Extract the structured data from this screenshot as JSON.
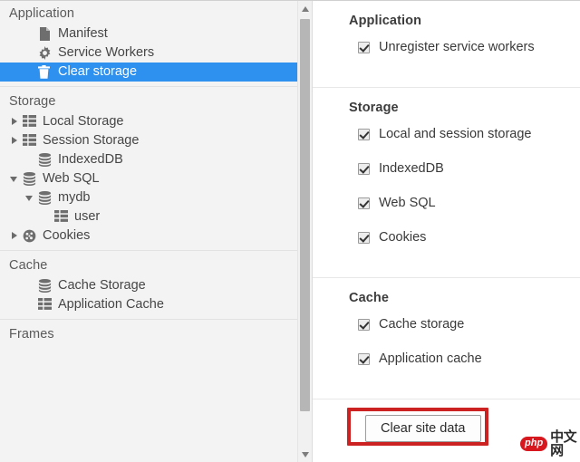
{
  "colors": {
    "selection_blue": "#2e90ef",
    "highlight_red": "#cc2222",
    "panel_bg": "#f3f3f3",
    "detail_bg": "#ffffff"
  },
  "sidebar": {
    "groups": [
      {
        "title": "Application",
        "items": [
          {
            "label": "Manifest",
            "icon": "document-icon",
            "indent": 2,
            "twisty": "none",
            "selected": false
          },
          {
            "label": "Service Workers",
            "icon": "gear-icon",
            "indent": 2,
            "twisty": "none",
            "selected": false
          },
          {
            "label": "Clear storage",
            "icon": "trash-icon",
            "indent": 2,
            "twisty": "none",
            "selected": true
          }
        ]
      },
      {
        "title": "Storage",
        "items": [
          {
            "label": "Local Storage",
            "icon": "table-icon",
            "indent": 1,
            "twisty": "closed",
            "selected": false
          },
          {
            "label": "Session Storage",
            "icon": "table-icon",
            "indent": 1,
            "twisty": "closed",
            "selected": false
          },
          {
            "label": "IndexedDB",
            "icon": "database-icon",
            "indent": 2,
            "twisty": "none",
            "selected": false
          },
          {
            "label": "Web SQL",
            "icon": "database-icon",
            "indent": 1,
            "twisty": "open",
            "selected": false
          },
          {
            "label": "mydb",
            "icon": "database-icon",
            "indent": 2,
            "twisty": "open",
            "selected": false
          },
          {
            "label": "user",
            "icon": "table-icon",
            "indent": 3,
            "twisty": "none",
            "selected": false
          },
          {
            "label": "Cookies",
            "icon": "cookie-icon",
            "indent": 1,
            "twisty": "closed",
            "selected": false
          }
        ]
      },
      {
        "title": "Cache",
        "items": [
          {
            "label": "Cache Storage",
            "icon": "database-icon",
            "indent": 2,
            "twisty": "none",
            "selected": false
          },
          {
            "label": "Application Cache",
            "icon": "table-icon",
            "indent": 2,
            "twisty": "none",
            "selected": false
          }
        ]
      },
      {
        "title": "Frames",
        "items": []
      }
    ],
    "scrollbar": {
      "up_arrow": "scroll-up-arrow",
      "down_arrow": "scroll-down-arrow"
    }
  },
  "detail": {
    "sections": [
      {
        "title": "Application",
        "options": [
          {
            "label": "Unregister service workers",
            "checked": true
          }
        ]
      },
      {
        "title": "Storage",
        "options": [
          {
            "label": "Local and session storage",
            "checked": true
          },
          {
            "label": "IndexedDB",
            "checked": true
          },
          {
            "label": "Web SQL",
            "checked": true
          },
          {
            "label": "Cookies",
            "checked": true
          }
        ]
      },
      {
        "title": "Cache",
        "options": [
          {
            "label": "Cache storage",
            "checked": true
          },
          {
            "label": "Application cache",
            "checked": true
          }
        ]
      }
    ],
    "action": {
      "clear_button_label": "Clear site data"
    }
  },
  "watermark": {
    "badge": "php",
    "text": "中文网"
  }
}
